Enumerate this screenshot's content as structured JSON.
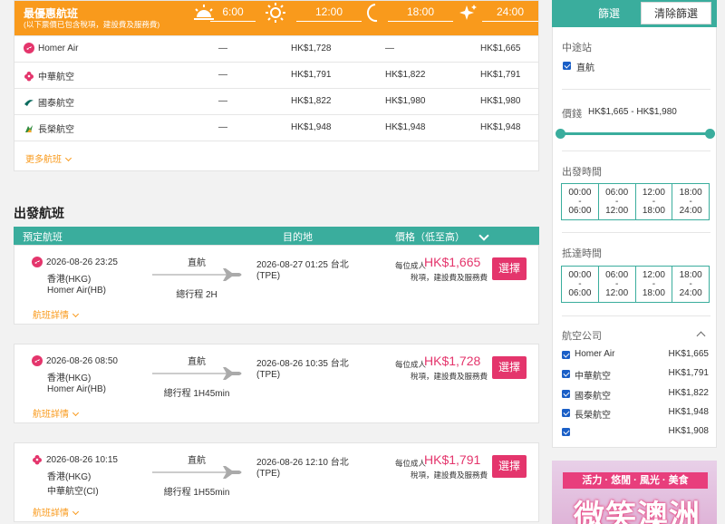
{
  "best": {
    "title": "最優惠航班",
    "subtitle": "(以下票價已包含稅項，建設費及服務費)",
    "times": [
      "6:00",
      "12:00",
      "18:00",
      "24:00"
    ],
    "rows": [
      {
        "airline": "Homer Air",
        "icon": "homer-air-logo-icon",
        "prices": [
          "—",
          "HK$1,728",
          "—",
          "HK$1,665"
        ]
      },
      {
        "airline": "中華航空",
        "icon": "china-airlines-logo-icon",
        "prices": [
          "—",
          "HK$1,791",
          "HK$1,822",
          "HK$1,791"
        ]
      },
      {
        "airline": "國泰航空",
        "icon": "cathay-pacific-logo-icon",
        "prices": [
          "—",
          "HK$1,822",
          "HK$1,980",
          "HK$1,980"
        ]
      },
      {
        "airline": "長榮航空",
        "icon": "eva-air-logo-icon",
        "prices": [
          "—",
          "HK$1,948",
          "HK$1,948",
          "HK$1,948"
        ]
      }
    ],
    "more_label": "更多航班"
  },
  "departure": {
    "title": "出發航班",
    "headers": {
      "flight": "預定航班",
      "destination": "目的地",
      "price": "價格（低至高）"
    },
    "cards": [
      {
        "dep_datetime": "2026-08-26 23:25",
        "dep_city": "香港(HKG)",
        "airline": "Homer Air(HB)",
        "direct": "直航",
        "duration": "總行程 2H",
        "arr_datetime": "2026-08-27 01:25 台北",
        "arr_code": "(TPE)",
        "price_label": "每位成人",
        "price": "HK$1,665",
        "tax_note": "稅項，建設費及服務費",
        "select": "選擇",
        "details": "航班詳情",
        "icon": "homer-air-logo-icon"
      },
      {
        "dep_datetime": "2026-08-26 08:50",
        "dep_city": "香港(HKG)",
        "airline": "Homer Air(HB)",
        "direct": "直航",
        "duration": "總行程 1H45min",
        "arr_datetime": "2026-08-26 10:35 台北",
        "arr_code": "(TPE)",
        "price_label": "每位成人",
        "price": "HK$1,728",
        "tax_note": "稅項，建設費及服務費",
        "select": "選擇",
        "details": "航班詳情",
        "icon": "homer-air-logo-icon"
      },
      {
        "dep_datetime": "2026-08-26 10:15",
        "dep_city": "香港(HKG)",
        "airline": "中華航空(CI)",
        "direct": "直航",
        "duration": "總行程 1H55min",
        "arr_datetime": "2026-08-26 12:10 台北",
        "arr_code": "(TPE)",
        "price_label": "每位成人",
        "price": "HK$1,791",
        "tax_note": "稅項，建設費及服務費",
        "select": "選擇",
        "details": "航班詳情",
        "icon": "china-airlines-logo-icon"
      }
    ]
  },
  "filter": {
    "title": "篩選",
    "clear": "清除篩選",
    "stops": {
      "title": "中途站",
      "option": "直航"
    },
    "price": {
      "title": "價錢",
      "range": "HK$1,665 - HK$1,980"
    },
    "depart_time": {
      "title": "出發時間",
      "slots": [
        [
          "00:00",
          "-",
          "06:00"
        ],
        [
          "06:00",
          "-",
          "12:00"
        ],
        [
          "12:00",
          "-",
          "18:00"
        ],
        [
          "18:00",
          "-",
          "24:00"
        ]
      ]
    },
    "arrive_time": {
      "title": "抵達時間",
      "slots": [
        [
          "00:00",
          "-",
          "06:00"
        ],
        [
          "06:00",
          "-",
          "12:00"
        ],
        [
          "12:00",
          "-",
          "18:00"
        ],
        [
          "18:00",
          "-",
          "24:00"
        ]
      ]
    },
    "airlines": {
      "title": "航空公司",
      "items": [
        {
          "name": "Homer Air",
          "price": "HK$1,665"
        },
        {
          "name": "中華航空",
          "price": "HK$1,791"
        },
        {
          "name": "國泰航空",
          "price": "HK$1,822"
        },
        {
          "name": "長榮航空",
          "price": "HK$1,948"
        },
        {
          "name": "",
          "price": "HK$1,908"
        }
      ]
    }
  },
  "ad": {
    "band": "活力 · 悠閒 · 風光 · 美食",
    "big": "微笑澳洲"
  },
  "colors": {
    "orange": "#f99a1c",
    "teal": "#3aad9d",
    "pink": "#e4356c",
    "checkbox": "#1a5fc7"
  }
}
